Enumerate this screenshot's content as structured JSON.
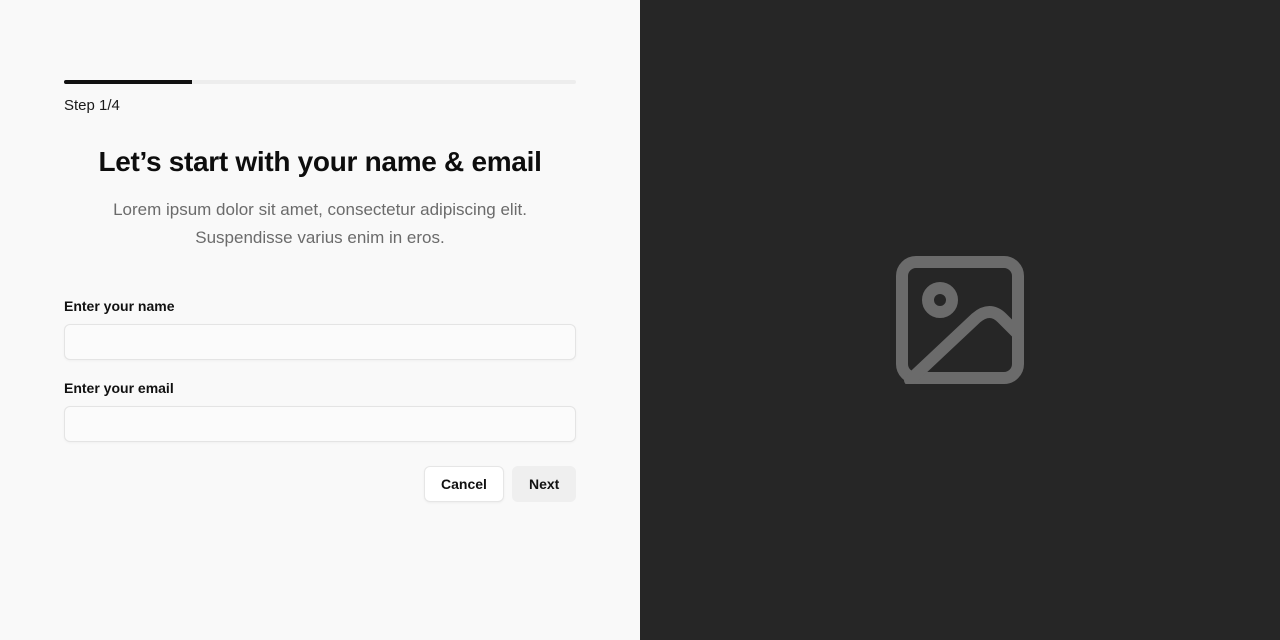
{
  "progress": {
    "current_step": 1,
    "total_steps": 4,
    "fraction": 0.25,
    "step_label": "Step 1/4"
  },
  "header": {
    "title": "Let’s start with your name & email",
    "subtitle_line1": "Lorem ipsum dolor sit amet, consectetur adipiscing elit.",
    "subtitle_line2": "Suspendisse varius enim in eros."
  },
  "form": {
    "name_label": "Enter your name",
    "name_value": "",
    "email_label": "Enter your email",
    "email_value": ""
  },
  "actions": {
    "cancel_label": "Cancel",
    "next_label": "Next"
  },
  "media": {
    "icon": "image-placeholder-icon",
    "background_color": "#262626",
    "icon_color": "#6b6b6b"
  },
  "colors": {
    "progress_fill": "#111111",
    "progress_track": "#ededed",
    "left_background": "#f9f9f9"
  }
}
